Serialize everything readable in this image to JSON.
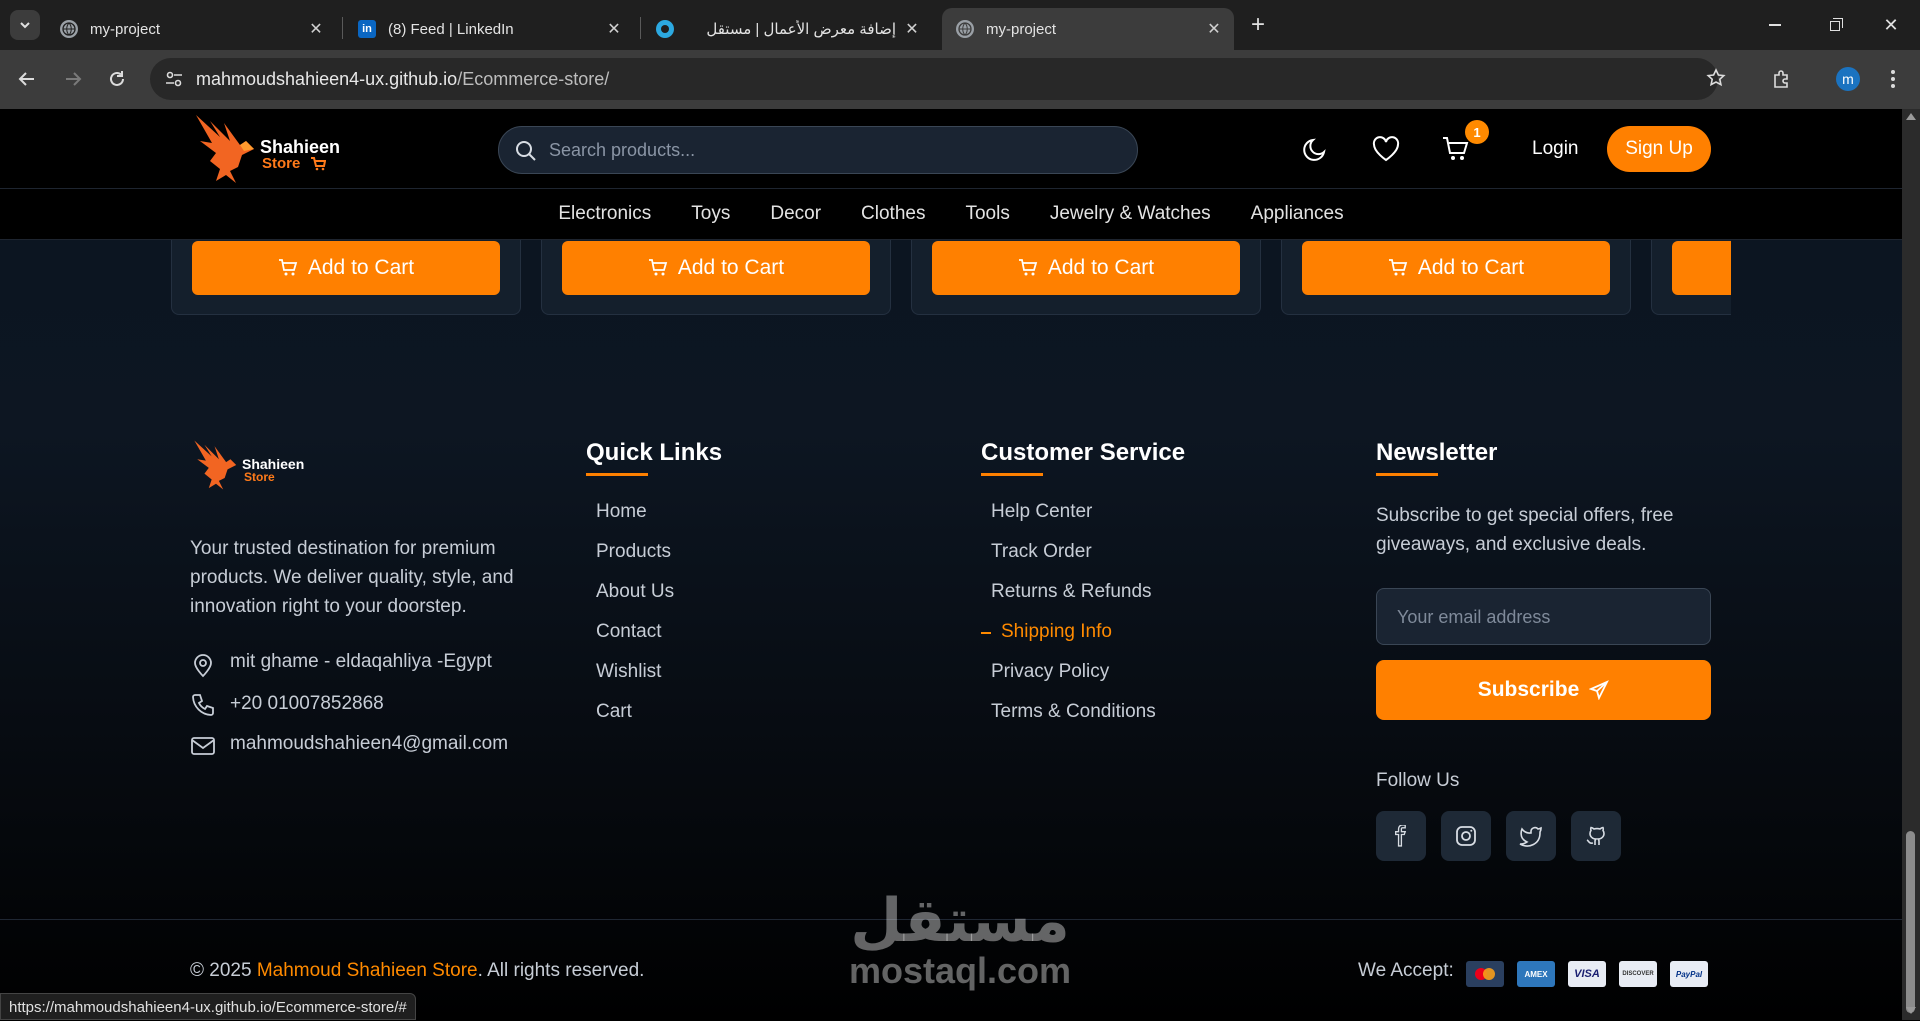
{
  "browser": {
    "tabs": [
      {
        "title": "my-project",
        "active": false,
        "icon": "globe-icon"
      },
      {
        "title": "(8) Feed | LinkedIn",
        "active": false,
        "icon": "linkedin-icon"
      },
      {
        "title": "إضافة معرض الأعمال | مستقل",
        "active": false,
        "icon": "mostaql-icon"
      },
      {
        "title": "my-project",
        "active": true,
        "icon": "globe-icon"
      }
    ],
    "url_host": "mahmoudshahieen4-ux.github.io",
    "url_path": "/Ecommerce-store/",
    "profile_initial": "m",
    "status_url": "https://mahmoudshahieen4-ux.github.io/Ecommerce-store/#"
  },
  "header": {
    "logo_line1": "Shahieen",
    "logo_line2": "Store",
    "search_placeholder": "Search products...",
    "cart_count": "1",
    "login_label": "Login",
    "signup_label": "Sign Up"
  },
  "categories": [
    "Electronics",
    "Toys",
    "Decor",
    "Clothes",
    "Tools",
    "Jewelry & Watches",
    "Appliances"
  ],
  "products": {
    "add_to_cart_label": "Add to Cart"
  },
  "footer": {
    "about": {
      "logo_line1": "Shahieen",
      "logo_line2": "Store",
      "description": "Your trusted destination for premium products. We deliver quality, style, and innovation right to your doorstep.",
      "address": "mit ghame - eldaqahliya -Egypt",
      "phone": "+20 01007852868",
      "email": "mahmoudshahieen4@gmail.com"
    },
    "quick_links": {
      "title": "Quick Links",
      "items": [
        "Home",
        "Products",
        "About Us",
        "Contact",
        "Wishlist",
        "Cart"
      ]
    },
    "customer_service": {
      "title": "Customer Service",
      "items": [
        "Help Center",
        "Track Order",
        "Returns & Refunds",
        "Shipping Info",
        "Privacy Policy",
        "Terms & Conditions"
      ],
      "active_item": "Shipping Info"
    },
    "newsletter": {
      "title": "Newsletter",
      "text": "Subscribe to get special offers, free giveaways, and exclusive deals.",
      "email_placeholder": "Your email address",
      "subscribe_label": "Subscribe",
      "follow_us": "Follow Us"
    },
    "copyright_prefix": "© 2025 ",
    "copyright_brand": "Mahmoud Shahieen Store",
    "copyright_suffix": ". All rights reserved.",
    "we_accept": "We Accept:",
    "payment_methods": [
      "MasterCard",
      "AMEX",
      "VISA",
      "DISCOVER",
      "PayPal"
    ]
  },
  "watermark": {
    "arabic": "مستقل",
    "latin": "mostaql.com"
  },
  "colors": {
    "accent": "#ff8000",
    "background": "#0b1420"
  }
}
